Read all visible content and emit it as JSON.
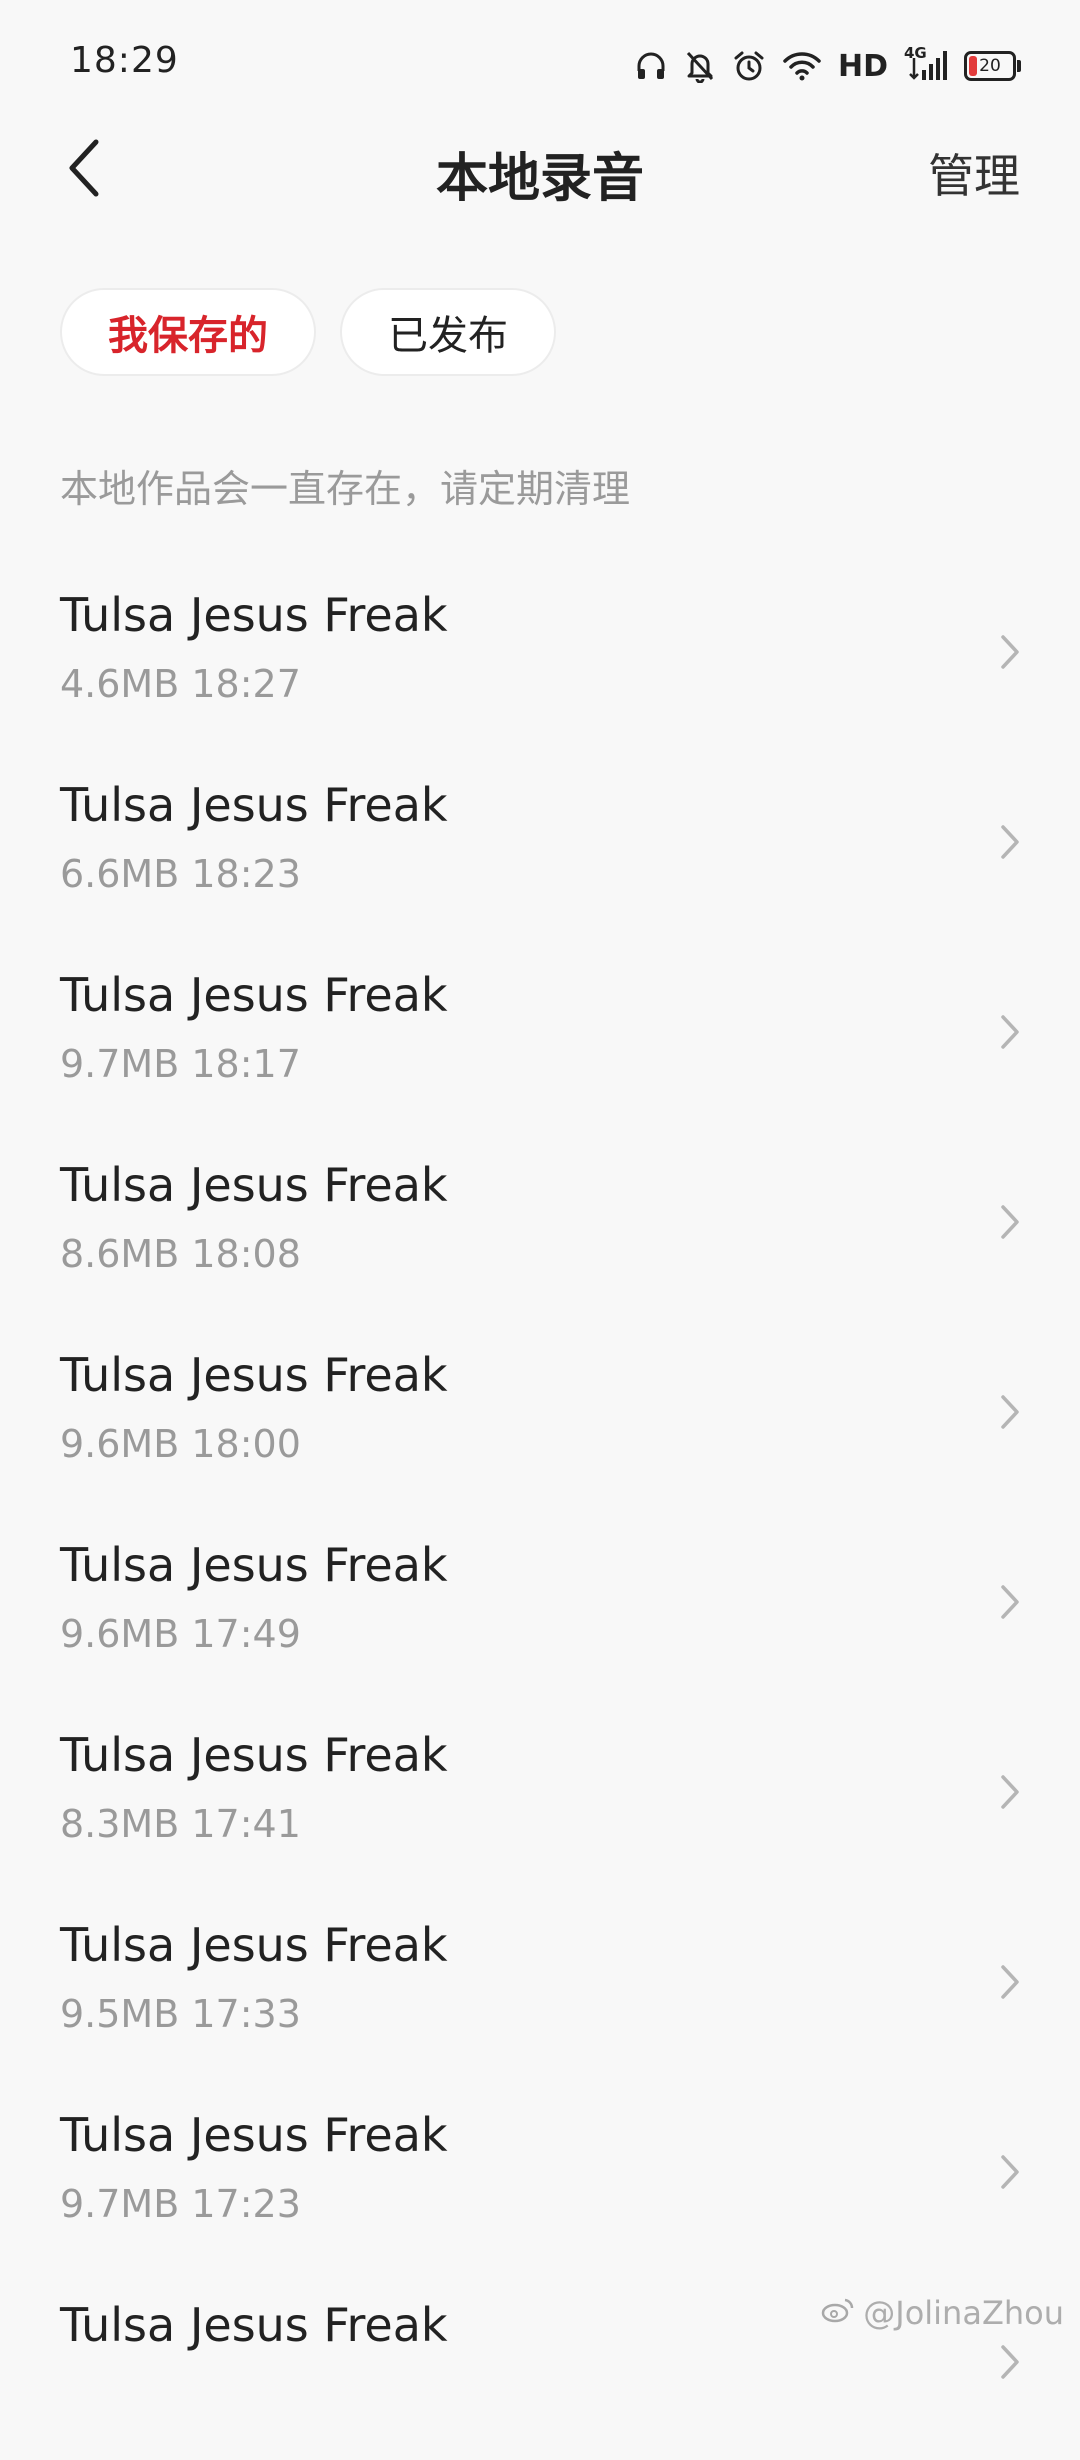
{
  "status_bar": {
    "time": "18:29",
    "network_label": "HD",
    "signal_label": "4G",
    "battery_level": "20",
    "icons": [
      "headphones-icon",
      "bell-off-icon",
      "alarm-icon",
      "wifi-icon",
      "signal-icon",
      "battery-icon"
    ]
  },
  "header": {
    "title": "本地录音",
    "manage_label": "管理",
    "back_icon": "chevron-left-icon"
  },
  "tabs": [
    {
      "label": "我保存的",
      "active": true
    },
    {
      "label": "已发布",
      "active": false
    }
  ],
  "notice": "本地作品会一直存在，请定期清理",
  "recordings": [
    {
      "title": "Tulsa Jesus Freak",
      "meta": "4.6MB 18:27"
    },
    {
      "title": "Tulsa Jesus Freak",
      "meta": "6.6MB 18:23"
    },
    {
      "title": "Tulsa Jesus Freak",
      "meta": "9.7MB 18:17"
    },
    {
      "title": "Tulsa Jesus Freak",
      "meta": "8.6MB 18:08"
    },
    {
      "title": "Tulsa Jesus Freak",
      "meta": "9.6MB 18:00"
    },
    {
      "title": "Tulsa Jesus Freak",
      "meta": "9.6MB 17:49"
    },
    {
      "title": "Tulsa Jesus Freak",
      "meta": "8.3MB 17:41"
    },
    {
      "title": "Tulsa Jesus Freak",
      "meta": "9.5MB 17:33"
    },
    {
      "title": "Tulsa Jesus Freak",
      "meta": "9.7MB 17:23"
    },
    {
      "title": "Tulsa Jesus Freak",
      "meta": ""
    }
  ],
  "watermark": "@JolinaZhou",
  "colors": {
    "accent": "#d8242b",
    "background": "#f8f8f8",
    "secondary_text": "#9a9a9a"
  }
}
